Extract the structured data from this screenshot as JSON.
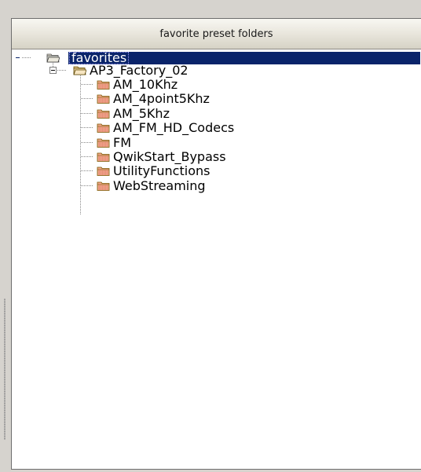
{
  "panel": {
    "header_title": "favorite preset folders"
  },
  "tree": {
    "root": {
      "label": "favorites",
      "expanded": true,
      "selected": true
    },
    "group": {
      "label": "AP3_Factory_02",
      "expanded": true
    },
    "children": [
      {
        "label": "AM_10Khz"
      },
      {
        "label": "AM_4point5Khz"
      },
      {
        "label": "AM_5Khz"
      },
      {
        "label": "AM_FM_HD_Codecs"
      },
      {
        "label": "FM"
      },
      {
        "label": "QwikStart_Bypass"
      },
      {
        "label": "UtilityFunctions"
      },
      {
        "label": "WebStreaming"
      }
    ]
  },
  "colors": {
    "selection": "#0a246a",
    "folder_fill": "#f0a58a",
    "folder_edge": "#7a5a00"
  }
}
